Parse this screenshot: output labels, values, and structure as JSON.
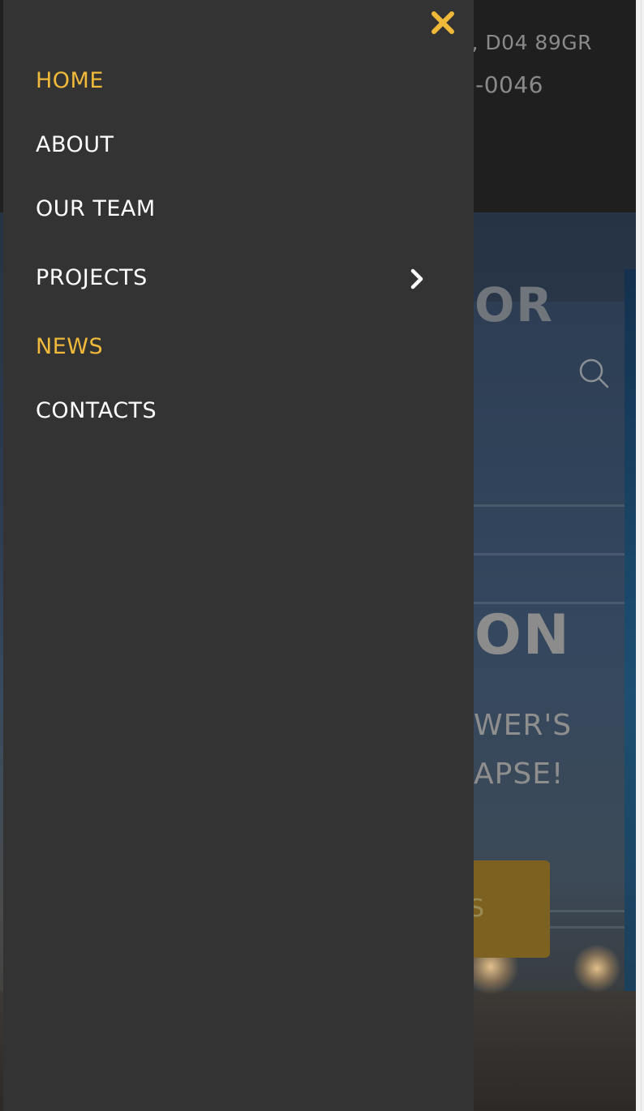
{
  "header": {
    "address": ", D04 89GR",
    "phone": "-0046"
  },
  "hero": {
    "brand_fragment": "OR",
    "headline": "ON",
    "subline_1": "WER'S",
    "subline_2": "APSE!",
    "cta_label": "S"
  },
  "menu": {
    "items": [
      {
        "label": "HOME",
        "active": true
      },
      {
        "label": "ABOUT",
        "active": false
      },
      {
        "label": "OUR TEAM",
        "active": false
      },
      {
        "label": "PROJECTS",
        "active": false,
        "has_submenu": true
      },
      {
        "label": "NEWS",
        "active": true
      },
      {
        "label": "CONTACTS",
        "active": false
      }
    ],
    "close_icon": "close-icon",
    "submenu_icon": "chevron-right-icon"
  },
  "colors": {
    "accent": "#f0b93a",
    "menu_bg": "#333333",
    "menu_text": "#ffffff",
    "cta_bg": "#7d6120"
  }
}
